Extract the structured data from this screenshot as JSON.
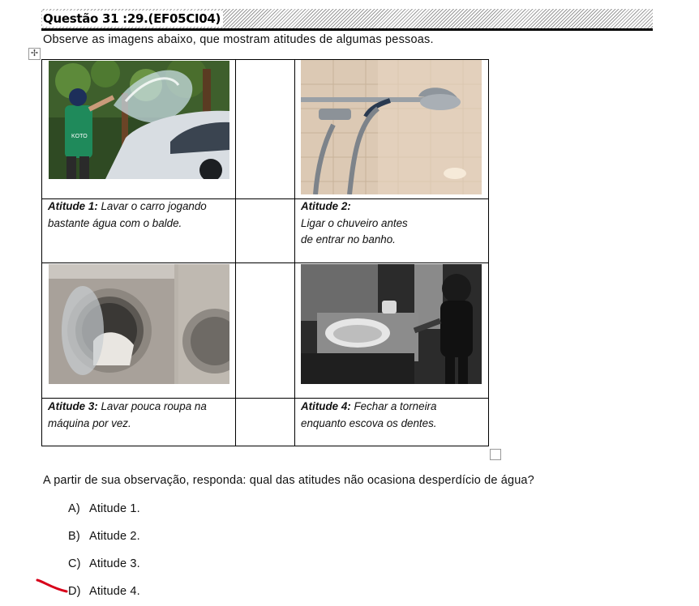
{
  "header": {
    "title": "Questão 31 :29.(EF05CI04)"
  },
  "intro": "Observe as imagens abaixo, que mostram atitudes de algumas pessoas.",
  "cards": [
    {
      "label": "Atitude 1:",
      "text_lines": [
        "Lavar o carro jogando",
        "bastante água com o balde."
      ]
    },
    {
      "label": "Atitude 2:",
      "text_lines": [
        "",
        "Ligar o chuveiro antes",
        "de entrar no banho."
      ]
    },
    {
      "label": "Atitude 3:",
      "text_lines": [
        "Lavar pouca roupa na",
        "máquina por vez."
      ]
    },
    {
      "label": "Atitude 4:",
      "text_lines": [
        "Fechar a torneira",
        "enquanto escova os dentes."
      ]
    }
  ],
  "question": "A partir de sua observação, responda: qual das atitudes não ocasiona desperdício de água?",
  "options": [
    {
      "letter": "A)",
      "text": "Atitude 1."
    },
    {
      "letter": "B)",
      "text": "Atitude 2."
    },
    {
      "letter": "C)",
      "text": "Atitude 3."
    },
    {
      "letter": "D)",
      "text": "Atitude 4."
    }
  ],
  "annotation_color": "#d8001a"
}
